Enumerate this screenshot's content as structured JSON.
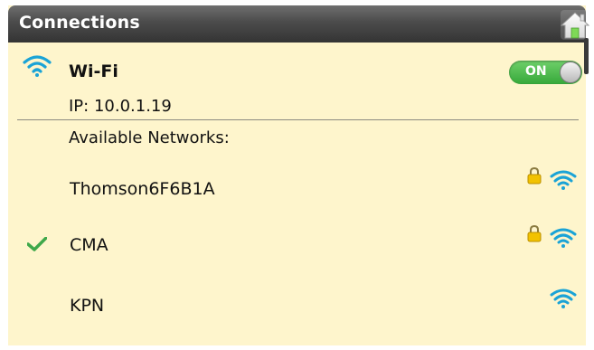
{
  "header": {
    "title": "Connections",
    "home_icon": "home-icon"
  },
  "wifi": {
    "label": "Wi-Fi",
    "toggle_label": "ON",
    "enabled": true,
    "ip_text": "IP: 10.0.1.19"
  },
  "networks_heading": "Available Networks:",
  "networks": [
    {
      "name": "Thomson6F6B1A",
      "secured": true,
      "connected": false
    },
    {
      "name": "CMA",
      "secured": true,
      "connected": true
    },
    {
      "name": "KPN",
      "secured": false,
      "connected": false
    }
  ],
  "colors": {
    "background": "#fef5cc",
    "header": "#3c3c3c",
    "toggle_on": "#4cbb4a",
    "wifi_blue": "#1aa3d6"
  }
}
